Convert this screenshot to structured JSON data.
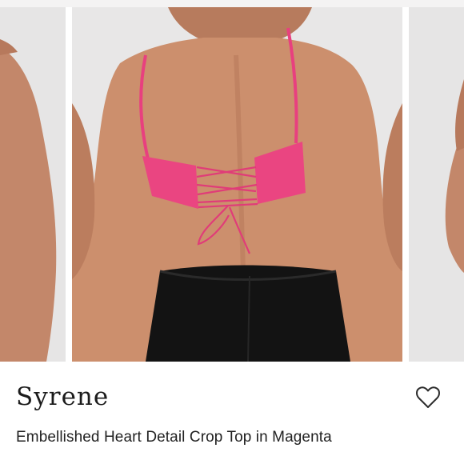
{
  "product": {
    "brand": "Syrene",
    "title": "Embellished Heart Detail Crop Top in Magenta",
    "favorite_icon": "heart-outline-icon"
  },
  "gallery": {
    "images": [
      {
        "name": "previous-product-photo"
      },
      {
        "name": "current-product-photo-back-view"
      },
      {
        "name": "next-product-photo"
      }
    ]
  },
  "colors": {
    "background": "#ffffff",
    "photo_backdrop": "#e7e6e6",
    "skin": "#c98d6c",
    "garment_magenta": "#e8407f",
    "skirt_black": "#121212"
  }
}
